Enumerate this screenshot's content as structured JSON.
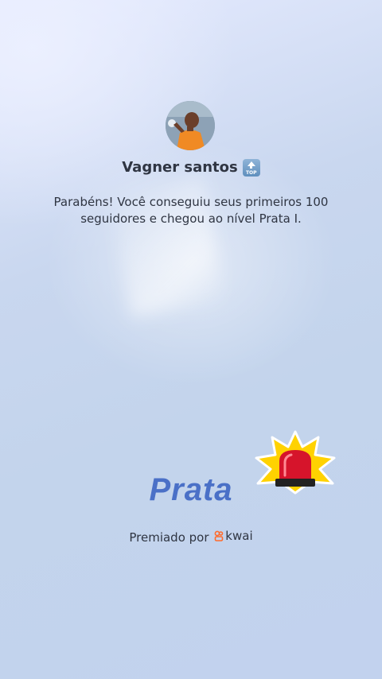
{
  "profile": {
    "username": "Vagner santos",
    "badge_text": "TOP",
    "avatar_alt": "profile photo"
  },
  "message": "Parabéns! Você conseguiu seus primeiros 100 seguidores e chegou ao nível Prata I.",
  "level": {
    "name": "Prata"
  },
  "footer": {
    "awarded_by": "Premiado por",
    "brand_name": "kwai"
  },
  "colors": {
    "level_text": "#4a70c7",
    "brand_orange": "#ff6b2c",
    "siren_red": "#d6142b",
    "burst_yellow": "#ffd200"
  },
  "icons": {
    "top_badge": "top-badge-icon",
    "siren": "siren-icon",
    "brand_logo": "kwai-logo-icon"
  }
}
